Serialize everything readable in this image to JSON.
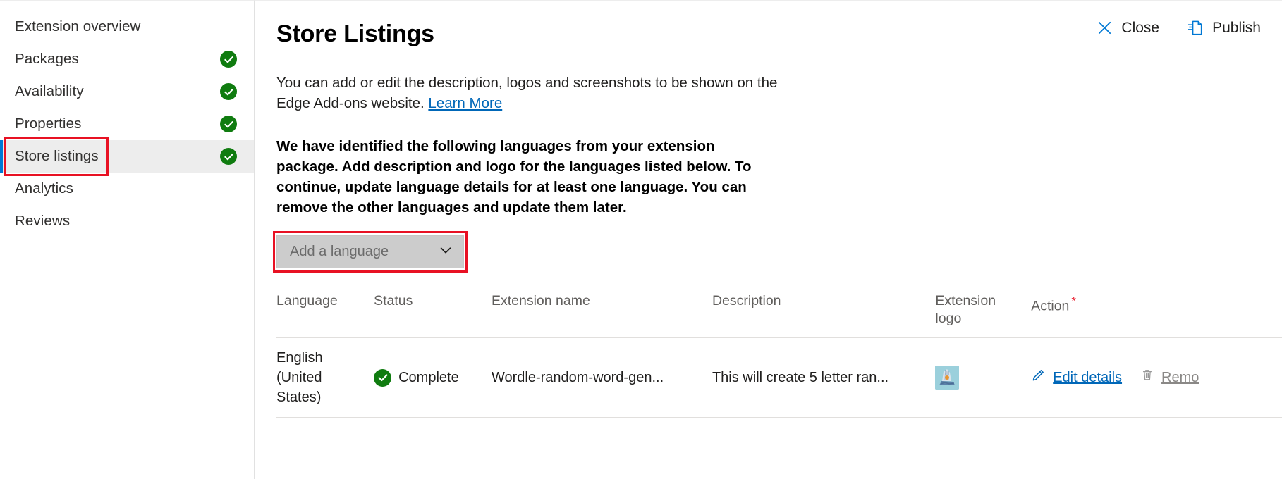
{
  "sidebar": {
    "items": [
      {
        "label": "Extension overview",
        "complete": false,
        "selected": false
      },
      {
        "label": "Packages",
        "complete": true,
        "selected": false
      },
      {
        "label": "Availability",
        "complete": true,
        "selected": false
      },
      {
        "label": "Properties",
        "complete": true,
        "selected": false
      },
      {
        "label": "Store listings",
        "complete": true,
        "selected": true
      },
      {
        "label": "Analytics",
        "complete": false,
        "selected": false
      },
      {
        "label": "Reviews",
        "complete": false,
        "selected": false
      }
    ]
  },
  "header": {
    "title": "Store Listings",
    "close_label": "Close",
    "publish_label": "Publish",
    "close_icon": "close-x-icon",
    "publish_icon": "publish-document-icon"
  },
  "intro": {
    "text_before_link": "You can add or edit the description, logos and screenshots to be shown on the Edge Add-ons website. ",
    "link_label": "Learn More"
  },
  "languages_note": "We have identified the following languages from your extension package. Add description and logo for the languages listed below. To continue, update language details for at least one language. You can remove the other languages and update them later.",
  "dropdown": {
    "placeholder": "Add a language",
    "chevron_icon": "chevron-down-icon"
  },
  "table": {
    "columns": [
      {
        "key": "language",
        "label": "Language",
        "required": false
      },
      {
        "key": "status",
        "label": "Status",
        "required": false
      },
      {
        "key": "extname",
        "label": "Extension name",
        "required": false
      },
      {
        "key": "desc",
        "label": "Description",
        "required": false
      },
      {
        "key": "logo",
        "label": "Extension logo",
        "required": false
      },
      {
        "key": "action",
        "label": "Action",
        "required": true
      }
    ],
    "rows": [
      {
        "language": "English (United States)",
        "status": "Complete",
        "status_icon": "check-circle-icon",
        "extension_name": "Wordle-random-word-gen...",
        "description": "This will create 5 letter ran...",
        "logo_icon": "extension-logo-thumbnail",
        "edit_label": "Edit details",
        "edit_icon": "pencil-icon",
        "remove_label": "Remo",
        "remove_icon": "trash-icon"
      }
    ]
  },
  "colors": {
    "accent": "#0078d4",
    "link": "#0067b8",
    "success": "#107c10",
    "annotation": "#e81123",
    "required": "#e81123",
    "selected_bg": "#ededed",
    "dropdown_bg": "#cccccc"
  }
}
